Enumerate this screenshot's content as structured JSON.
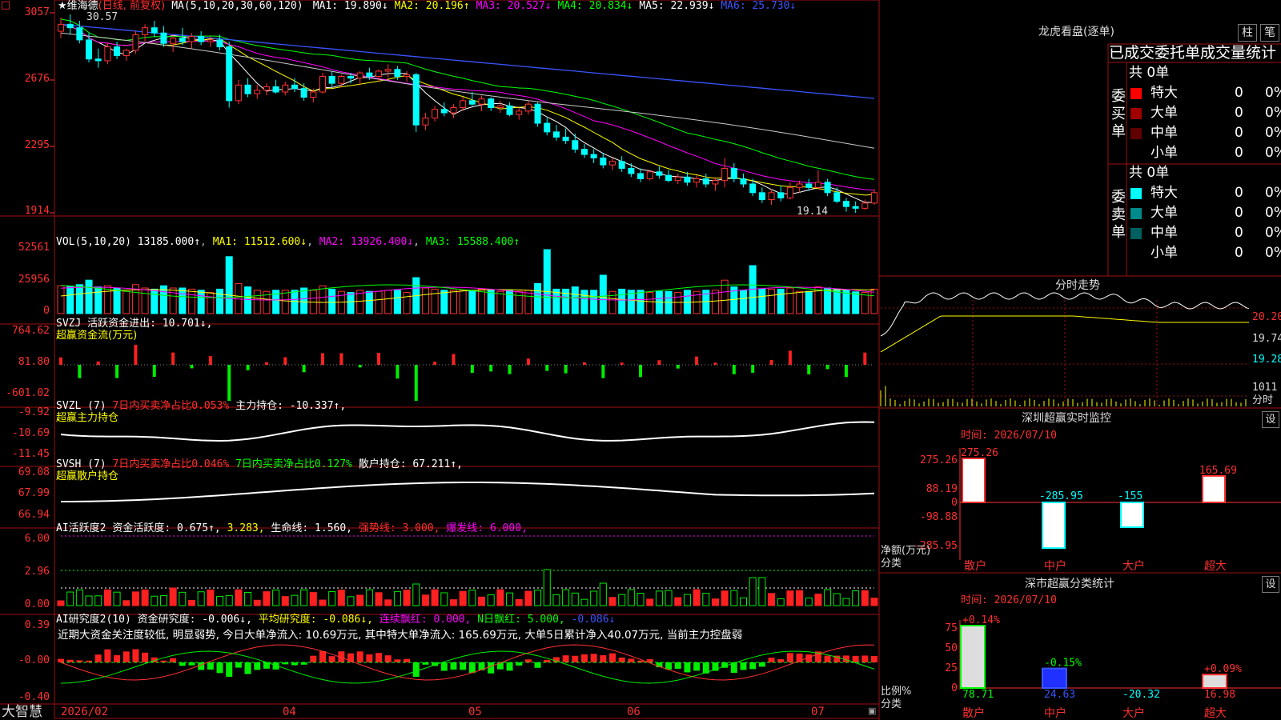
{
  "app": {
    "name": "大智慧",
    "top_marker": "□"
  },
  "main": {
    "header": {
      "title": "★维海德",
      "mode": "(日线, 前复权)",
      "ma_label": "MA(5,10,20,30,60,120)",
      "items": [
        {
          "text": "MA1: 19.890↓",
          "color": "#ffffff"
        },
        {
          "text": "MA2: 20.196↑",
          "color": "#ffff00"
        },
        {
          "text": "MA3: 20.527↓",
          "color": "#ff00ff"
        },
        {
          "text": "MA4: 20.834↓",
          "color": "#00ff00"
        },
        {
          "text": "MA5: 22.939↓",
          "color": "#ffffff"
        },
        {
          "text": "MA6: 25.730↓",
          "color": "#3a55ff"
        }
      ]
    },
    "yaxis": [
      "3057",
      "2676",
      "2295",
      "1914"
    ],
    "hi_label": "30.57",
    "lo_label": "19.14"
  },
  "vol": {
    "header": "VOL(5,10,20)",
    "value": "13185.000↑",
    "ma1": "MA1: 11512.600↓",
    "ma2": "MA2: 13926.400↓",
    "ma3": "MA3: 15588.400↑",
    "yaxis": [
      "52561",
      "25956",
      "0"
    ]
  },
  "svzj": {
    "header": "SVZJ  活跃资金进出: 10.701↓,",
    "sub": "超赢资金流(万元)",
    "yaxis": [
      "764.62",
      "81.80",
      "-601.02"
    ]
  },
  "svzl": {
    "head": "SVZL (7)",
    "part1": "7日内买卖净占比0.053%",
    "part2": "主力持仓: -10.337↑,",
    "sub": "超赢主力持仓",
    "yaxis": [
      "-9.92",
      "-10.69",
      "-11.45"
    ]
  },
  "svsh": {
    "head": "SVSH (7)",
    "part1": "7日内买卖净占比0.046%",
    "part2": "7日内买卖净占比0.127%",
    "part3": "散户持仓: 67.211↑,",
    "sub": "超赢散户持仓",
    "yaxis": [
      "69.08",
      "67.99",
      "66.94"
    ]
  },
  "ai1": {
    "head": "AI活跃度2",
    "part1": "资金活跃度: 0.675↑,",
    "part2": "3.283,",
    "part3": "生命线: 1.560,",
    "part4": "强势线: 3.000,",
    "part5": "爆发线: 6.000,",
    "yaxis": [
      "6.00",
      "2.96",
      "0.00"
    ]
  },
  "ai2": {
    "head": "AI研究度2(10)",
    "part1": "资金研究度: -0.006↓,",
    "part2": "平均研究度: -0.086↓,",
    "part3": "连续飘红: 0.000,",
    "part4": "N日飘红: 5.000,",
    "part5": "-0.086↓",
    "note": "近期大资金关注度较低, 明显弱势, 今日大单净流入: 10.69万元, 其中特大单净流入: 165.69万元, 大单5日累计净入40.07万元, 当前主力控盘弱",
    "yaxis": [
      "0.39",
      "-0.00",
      "-0.40"
    ]
  },
  "xaxis": [
    "2026/02",
    "04",
    "05",
    "06",
    "07"
  ],
  "right": {
    "lhb_title": "龙虎看盘(逐单)",
    "btn_bar": "柱",
    "btn_bi": "笔",
    "stat_title": "已成交委托单成交量统计",
    "buy_label": "委买单",
    "sell_label": "委卖单",
    "buy_total": "共 0单",
    "sell_total": "共 0单",
    "buy_rows": [
      {
        "name": "特大",
        "vol": "0",
        "pct": "0%",
        "color": "#ff0000"
      },
      {
        "name": "大单",
        "vol": "0",
        "pct": "0%",
        "color": "#a00000"
      },
      {
        "name": "中单",
        "vol": "0",
        "pct": "0%",
        "color": "#600000"
      },
      {
        "name": "小单",
        "vol": "0",
        "pct": "0%",
        "color": ""
      }
    ],
    "sell_rows": [
      {
        "name": "特大",
        "vol": "0",
        "pct": "0%",
        "color": "#00ffff"
      },
      {
        "name": "大单",
        "vol": "0",
        "pct": "0%",
        "color": "#008a8a"
      },
      {
        "name": "中单",
        "vol": "0",
        "pct": "0%",
        "color": "#006060"
      },
      {
        "name": "小单",
        "vol": "0",
        "pct": "0%",
        "color": ""
      }
    ],
    "intraday": {
      "title": "分时走势",
      "yaxis": [
        "20.20",
        "19.74",
        "19.28"
      ],
      "vol_label": "1011",
      "unit": "分时"
    },
    "sz_monitor": {
      "title": "深圳超赢实时监控",
      "btn": "设",
      "time": "时间: 2026/07/10",
      "unit": "净额(万元)",
      "cat": "分类"
    },
    "sz_class": {
      "title": "深市超赢分类统计",
      "btn": "设",
      "time": "时间: 2026/07/10",
      "unit": "比例%",
      "cat": "分类"
    }
  },
  "chart_data": [
    {
      "type": "candlestick",
      "title": "维海德 (日线, 前复权)",
      "y_axis_ticks": [
        30.57,
        26.76,
        22.95,
        19.14
      ],
      "series_ma": [
        "MA1",
        "MA2",
        "MA3",
        "MA4",
        "MA5",
        "MA6"
      ],
      "ohlc": [
        [
          29.6,
          30.4,
          29.2,
          30.0
        ],
        [
          30.0,
          30.57,
          29.4,
          29.8
        ],
        [
          29.8,
          30.2,
          28.9,
          29.1
        ],
        [
          29.1,
          29.5,
          27.8,
          28.0
        ],
        [
          28.0,
          28.6,
          27.5,
          27.9
        ],
        [
          27.9,
          28.9,
          27.7,
          28.7
        ],
        [
          28.7,
          29.0,
          28.0,
          28.2
        ],
        [
          28.2,
          28.6,
          27.9,
          28.5
        ],
        [
          28.5,
          29.6,
          28.3,
          29.4
        ],
        [
          29.4,
          30.0,
          29.0,
          29.8
        ],
        [
          29.8,
          30.2,
          29.3,
          29.5
        ],
        [
          29.5,
          29.9,
          28.7,
          28.9
        ],
        [
          28.9,
          29.4,
          28.4,
          29.2
        ],
        [
          29.2,
          29.8,
          28.8,
          29.0
        ],
        [
          29.0,
          29.5,
          28.6,
          29.3
        ],
        [
          29.3,
          29.6,
          28.8,
          29.0
        ],
        [
          29.0,
          29.3,
          28.7,
          29.1
        ],
        [
          29.1,
          29.4,
          28.5,
          28.7
        ],
        [
          28.7,
          29.0,
          25.2,
          25.6
        ],
        [
          25.6,
          26.8,
          25.4,
          26.5
        ],
        [
          26.5,
          26.9,
          25.8,
          26.0
        ],
        [
          26.0,
          26.5,
          25.7,
          26.2
        ],
        [
          26.2,
          26.6,
          25.9,
          26.4
        ],
        [
          26.4,
          26.8,
          26.0,
          26.1
        ],
        [
          26.1,
          26.7,
          25.9,
          26.5
        ],
        [
          26.5,
          26.9,
          26.1,
          26.3
        ],
        [
          26.3,
          26.6,
          25.6,
          25.8
        ],
        [
          25.8,
          26.3,
          25.5,
          26.1
        ],
        [
          26.1,
          27.2,
          26.0,
          27.0
        ],
        [
          27.0,
          27.3,
          26.4,
          26.6
        ],
        [
          26.6,
          27.1,
          26.4,
          27.0
        ],
        [
          27.0,
          27.2,
          26.6,
          26.9
        ],
        [
          26.9,
          27.3,
          26.5,
          27.2
        ],
        [
          27.2,
          27.5,
          26.8,
          27.0
        ],
        [
          27.0,
          27.4,
          26.7,
          27.3
        ],
        [
          27.3,
          27.7,
          26.9,
          27.4
        ],
        [
          27.4,
          27.6,
          26.8,
          27.0
        ],
        [
          27.0,
          27.3,
          26.7,
          27.1
        ],
        [
          27.1,
          27.2,
          23.8,
          24.2
        ],
        [
          24.2,
          24.9,
          23.9,
          24.6
        ],
        [
          24.6,
          25.3,
          24.4,
          25.1
        ],
        [
          25.1,
          25.5,
          24.7,
          24.9
        ],
        [
          24.9,
          25.4,
          24.6,
          25.2
        ],
        [
          25.2,
          25.8,
          25.0,
          25.6
        ],
        [
          25.6,
          26.1,
          25.3,
          25.4
        ],
        [
          25.4,
          25.9,
          25.0,
          25.7
        ],
        [
          25.7,
          25.8,
          25.0,
          25.2
        ],
        [
          25.2,
          25.6,
          24.9,
          25.3
        ],
        [
          25.3,
          25.5,
          24.7,
          24.8
        ],
        [
          24.8,
          25.2,
          24.5,
          25.0
        ],
        [
          25.0,
          25.6,
          24.8,
          25.4
        ],
        [
          25.4,
          25.5,
          24.1,
          24.3
        ],
        [
          24.3,
          24.6,
          23.6,
          23.8
        ],
        [
          23.8,
          24.2,
          23.3,
          23.5
        ],
        [
          23.5,
          24.0,
          23.1,
          23.3
        ],
        [
          23.3,
          23.7,
          22.6,
          22.8
        ],
        [
          22.8,
          23.1,
          22.3,
          22.5
        ],
        [
          22.5,
          22.8,
          22.0,
          22.3
        ],
        [
          22.3,
          22.6,
          21.7,
          21.9
        ],
        [
          21.9,
          22.3,
          21.6,
          22.1
        ],
        [
          22.1,
          22.4,
          21.5,
          21.7
        ],
        [
          21.7,
          22.0,
          21.2,
          21.4
        ],
        [
          21.4,
          21.7,
          20.9,
          21.1
        ],
        [
          21.1,
          21.6,
          21.0,
          21.5
        ],
        [
          21.5,
          21.8,
          21.1,
          21.3
        ],
        [
          21.3,
          21.6,
          20.9,
          21.0
        ],
        [
          21.0,
          21.4,
          20.8,
          21.2
        ],
        [
          21.2,
          21.5,
          20.7,
          20.9
        ],
        [
          20.9,
          21.3,
          20.6,
          21.1
        ],
        [
          21.1,
          21.4,
          20.6,
          20.8
        ],
        [
          20.8,
          21.2,
          20.4,
          21.0
        ],
        [
          21.0,
          22.3,
          20.6,
          21.7
        ],
        [
          21.7,
          22.0,
          20.9,
          21.1
        ],
        [
          21.1,
          21.4,
          20.6,
          20.8
        ],
        [
          20.8,
          21.1,
          20.1,
          20.3
        ],
        [
          20.3,
          20.6,
          19.7,
          19.9
        ],
        [
          19.9,
          20.5,
          19.6,
          20.3
        ],
        [
          20.3,
          20.7,
          19.8,
          20.0
        ],
        [
          20.0,
          20.9,
          19.9,
          20.6
        ],
        [
          20.6,
          21.0,
          20.3,
          20.8
        ],
        [
          20.8,
          21.1,
          20.4,
          20.6
        ],
        [
          20.6,
          21.6,
          20.5,
          20.9
        ],
        [
          20.9,
          21.1,
          20.1,
          20.3
        ],
        [
          20.3,
          20.6,
          19.7,
          19.8
        ],
        [
          19.8,
          20.0,
          19.2,
          19.5
        ],
        [
          19.5,
          19.8,
          19.14,
          19.4
        ],
        [
          19.4,
          19.9,
          19.3,
          19.7
        ],
        [
          19.7,
          20.5,
          19.6,
          20.3
        ]
      ]
    },
    {
      "type": "bar",
      "title": "VOL(5,10,20)",
      "y_axis_ticks": [
        52561,
        25956,
        0
      ],
      "last": 13185.0,
      "ma": {
        "MA1": 11512.6,
        "MA2": 13926.4,
        "MA3": 15588.4
      }
    },
    {
      "type": "bar",
      "title": "超赢资金流(万元)",
      "y_axis_ticks": [
        764.62,
        81.8,
        -601.02
      ],
      "last": 10.701
    },
    {
      "type": "line",
      "title": "超赢主力持仓",
      "y_axis_ticks": [
        -9.92,
        -10.69,
        -11.45
      ],
      "last": -10.337
    },
    {
      "type": "line",
      "title": "超赢散户持仓",
      "y_axis_ticks": [
        69.08,
        67.99,
        66.94
      ],
      "last": 67.211
    },
    {
      "type": "bar",
      "title": "AI活跃度2",
      "y_axis_ticks": [
        6.0,
        2.96,
        0.0
      ],
      "values": {
        "资金活跃度": 0.675,
        "生命线": 1.56,
        "强势线": 3.0,
        "爆发线": 6.0
      }
    },
    {
      "type": "bar",
      "title": "AI研究度2(10)",
      "y_axis_ticks": [
        0.39,
        -0.0,
        -0.4
      ],
      "values": {
        "资金研究度": -0.006,
        "平均研究度": -0.086,
        "连续飘红": 0.0,
        "N日飘红": 5.0
      }
    },
    {
      "type": "line",
      "title": "分时走势",
      "y_axis_ticks": [
        20.2,
        19.74,
        19.28
      ]
    },
    {
      "type": "bar",
      "title": "深圳超赢实时监控",
      "y_axis_ticks": [
        275.26,
        88.19,
        0,
        -98.88,
        -285.95
      ],
      "categories": [
        "散户",
        "中户",
        "大户",
        "超大"
      ],
      "values": [
        275.26,
        -285.95,
        -155,
        165.69
      ]
    },
    {
      "type": "bar",
      "title": "深市超赢分类统计",
      "y_axis_ticks": [
        75,
        50,
        25,
        0
      ],
      "categories": [
        "散户",
        "中户",
        "大户",
        "超大"
      ],
      "values": [
        78.71,
        24.63,
        -20.32,
        16.98
      ],
      "changes": [
        "+0.14%",
        "-0.15%",
        "",
        "+0.09%"
      ]
    }
  ]
}
